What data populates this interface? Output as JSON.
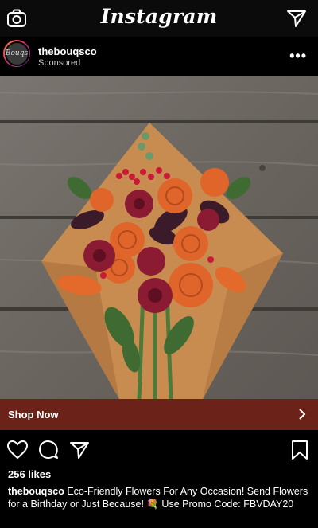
{
  "app": {
    "title": "Instagram"
  },
  "post": {
    "username": "thebouqsco",
    "sponsored_label": "Sponsored",
    "more_label": "•••",
    "avatar_text": "Bouqs",
    "cta_label": "Shop Now",
    "likes": "256 likes",
    "caption_user": "thebouqsco",
    "caption_text": "Eco-Friendly Flowers For Any Occasion! Send Flowers for a Birthday or Just Because! 💐 Use Promo Code: FBVDAY20"
  },
  "colors": {
    "cta_bg": "#6b2219",
    "background": "#000000",
    "wood": "#6f6a63",
    "paper": "#c88c51"
  },
  "icons": [
    "camera-icon",
    "send-icon",
    "more-icon",
    "chevron-right-icon",
    "heart-icon",
    "comment-icon",
    "share-icon",
    "bookmark-icon"
  ]
}
